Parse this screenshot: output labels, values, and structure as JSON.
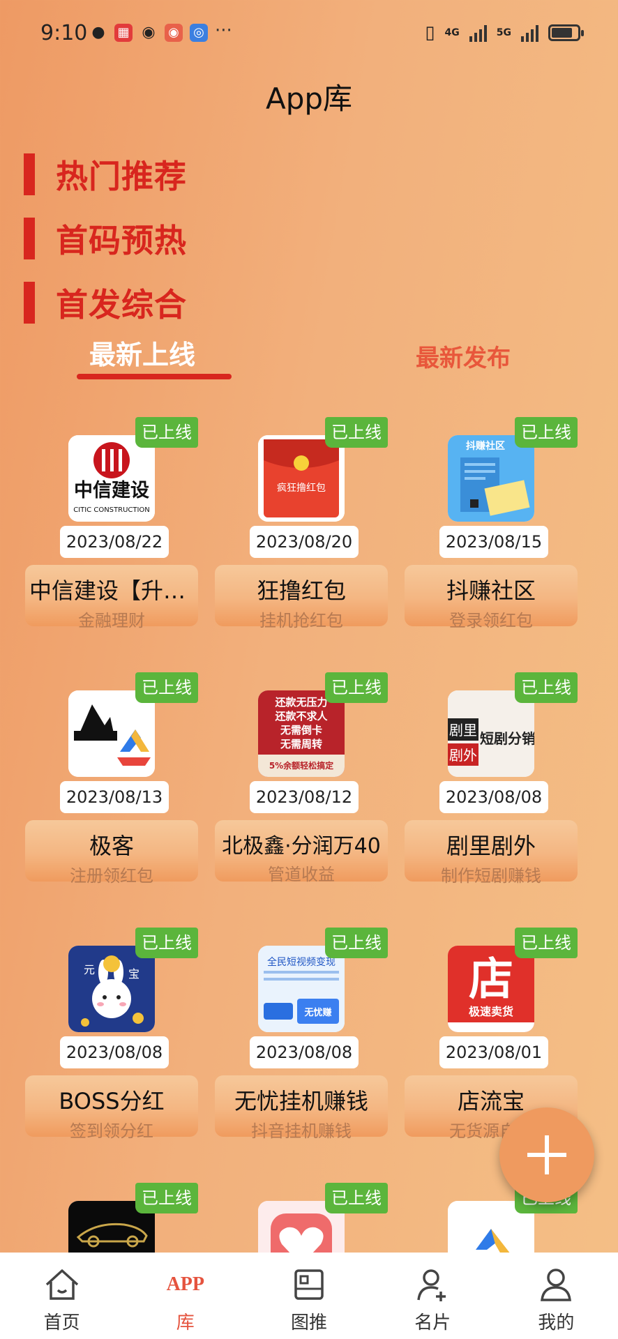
{
  "status_bar": {
    "time": "9:10",
    "more": "···",
    "net1": "4G",
    "net2": "5G",
    "battery_level": 0.8
  },
  "header": {
    "title": "App库"
  },
  "menu": [
    {
      "label": "热门推荐"
    },
    {
      "label": "首码预热"
    },
    {
      "label": "首发综合"
    }
  ],
  "tabs": {
    "active": "最新上线",
    "inactive": "最新发布"
  },
  "cards": [
    {
      "badge": "已上线",
      "date": "2023/08/22",
      "name": "中信建设【升级版】",
      "sub": "金融理财",
      "icon": "citic-logo-icon"
    },
    {
      "badge": "已上线",
      "date": "2023/08/20",
      "name": "狂撸红包",
      "sub": "挂机抢红包",
      "icon": "red-envelope-icon"
    },
    {
      "badge": "已上线",
      "date": "2023/08/15",
      "name": "抖赚社区",
      "sub": "登录领红包",
      "icon": "douzhuan-icon"
    },
    {
      "badge": "已上线",
      "date": "2023/08/13",
      "name": "极客",
      "sub": "注册领红包",
      "icon": "jike-logo-icon"
    },
    {
      "badge": "已上线",
      "date": "2023/08/12",
      "name": "北极鑫·分润万40",
      "sub": "管道收益",
      "icon": "beijixin-icon"
    },
    {
      "badge": "已上线",
      "date": "2023/08/08",
      "name": "剧里剧外",
      "sub": "制作短剧赚钱",
      "icon": "julijuwai-icon"
    },
    {
      "badge": "已上线",
      "date": "2023/08/08",
      "name": "BOSS分红",
      "sub": "签到领分红",
      "icon": "boss-rabbit-icon"
    },
    {
      "badge": "已上线",
      "date": "2023/08/08",
      "name": "无忧挂机赚钱",
      "sub": "抖音挂机赚钱",
      "icon": "wuyou-icon"
    },
    {
      "badge": "已上线",
      "date": "2023/08/01",
      "name": "店流宝",
      "sub": "无货源自动",
      "icon": "dianliubao-icon"
    },
    {
      "badge": "已上线",
      "icon": "car-logo-icon"
    },
    {
      "badge": "已上线",
      "icon": "heart-app-icon"
    },
    {
      "badge": "已上线",
      "icon": "triangle-app-icon"
    }
  ],
  "icon_text": {
    "citic_cn": "中信建设",
    "citic_en": "CITIC CONSTRUCTION",
    "hongbao": "疯狂撸红包",
    "douzhuan_title": "抖赚社区",
    "bjx_lines": [
      "还款无压力",
      "还款不求人",
      "无需倒卡",
      "无需周转"
    ],
    "bjx_footer": "5%余额轻松搞定",
    "jl_cn": "剧里",
    "jw_cn": "剧外",
    "jl_side": "短剧分销",
    "wuyou_title": "全民短视频变现",
    "wuyou_tag": "无忧赚",
    "dian_char": "店",
    "dian_sub": "极速卖货",
    "boss_left": "元",
    "boss_right": "宝"
  },
  "nav": [
    {
      "label": "首页",
      "icon": "home-icon"
    },
    {
      "label": "库",
      "logo": "APP",
      "icon": "app-library-icon",
      "active": true
    },
    {
      "label": "图推",
      "icon": "image-post-icon"
    },
    {
      "label": "名片",
      "icon": "add-contact-icon"
    },
    {
      "label": "我的",
      "icon": "profile-icon"
    }
  ],
  "colors": {
    "accent_red": "#d8261e",
    "badge_green": "#5bb53c",
    "nav_active": "#e5533e",
    "fab": "#ef9a5f"
  }
}
